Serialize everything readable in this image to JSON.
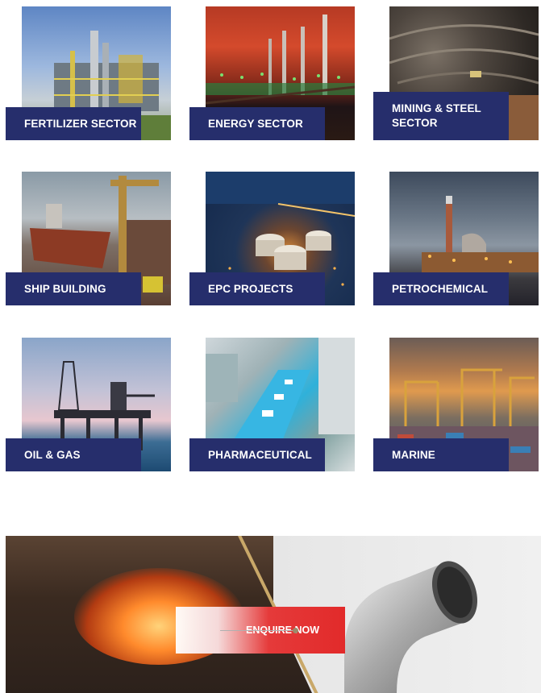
{
  "sectors": [
    {
      "label": "FERTILIZER SECTOR",
      "scene": "refinery-icon"
    },
    {
      "label": "ENERGY SECTOR",
      "scene": "power-plant-icon"
    },
    {
      "label": "MINING & STEEL SECTOR",
      "scene": "mine-icon"
    },
    {
      "label": "SHIP BUILDING",
      "scene": "ship-icon"
    },
    {
      "label": "EPC PROJECTS",
      "scene": "tanks-icon"
    },
    {
      "label": "PETROCHEMICAL",
      "scene": "chimney-icon"
    },
    {
      "label": "OIL & GAS",
      "scene": "rig-icon"
    },
    {
      "label": "PHARMACEUTICAL",
      "scene": "conveyor-icon"
    },
    {
      "label": "MARINE",
      "scene": "port-cranes-icon"
    }
  ],
  "banner": {
    "cta_label": "ENQUIRE NOW",
    "accent_color": "#e22a2a",
    "tile_label_color": "#262e6c"
  }
}
